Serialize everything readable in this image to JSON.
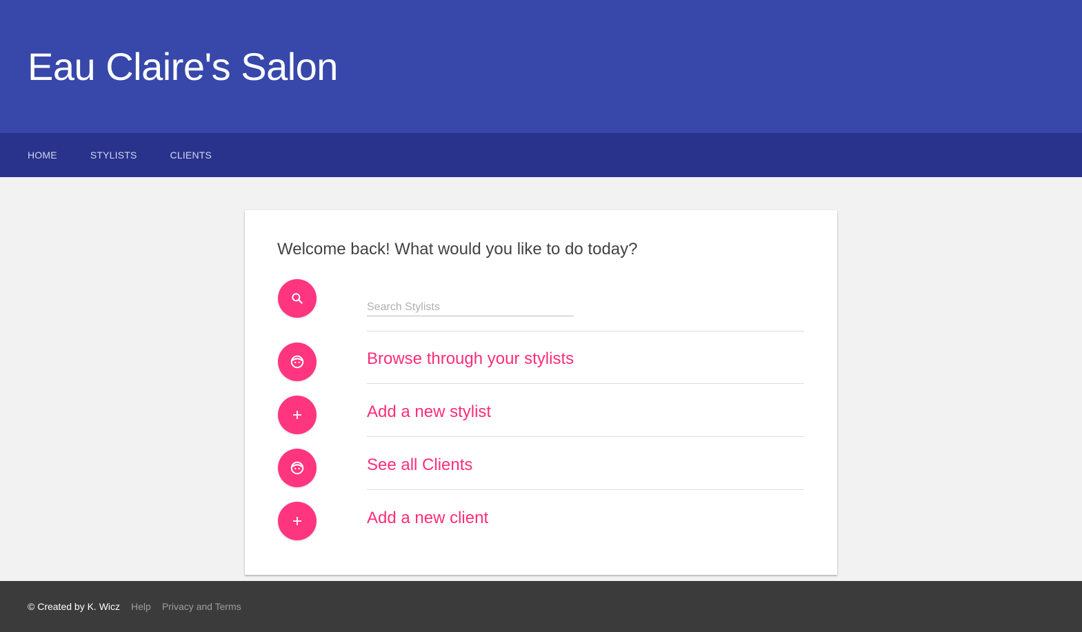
{
  "header": {
    "title": "Eau Claire's Salon"
  },
  "nav": {
    "items": [
      {
        "label": "Home"
      },
      {
        "label": "Stylists"
      },
      {
        "label": "Clients"
      }
    ]
  },
  "main": {
    "welcome": "Welcome back! What would you like to do today?",
    "search": {
      "placeholder": "Search Stylists",
      "value": ""
    },
    "actions": [
      {
        "label": "Browse through your stylists",
        "icon": "face-icon"
      },
      {
        "label": "Add a new stylist",
        "icon": "plus-icon"
      },
      {
        "label": "See all Clients",
        "icon": "face-icon"
      },
      {
        "label": "Add a new client",
        "icon": "plus-icon"
      }
    ]
  },
  "footer": {
    "copyright": "© Created by K. Wicz",
    "links": [
      {
        "label": "Help"
      },
      {
        "label": "Privacy and Terms"
      }
    ]
  },
  "colors": {
    "header_bg": "#3748aa",
    "nav_bg": "#29338c",
    "accent": "#ff3580",
    "footer_bg": "#3b3b3b",
    "page_bg": "#f2f2f2"
  }
}
